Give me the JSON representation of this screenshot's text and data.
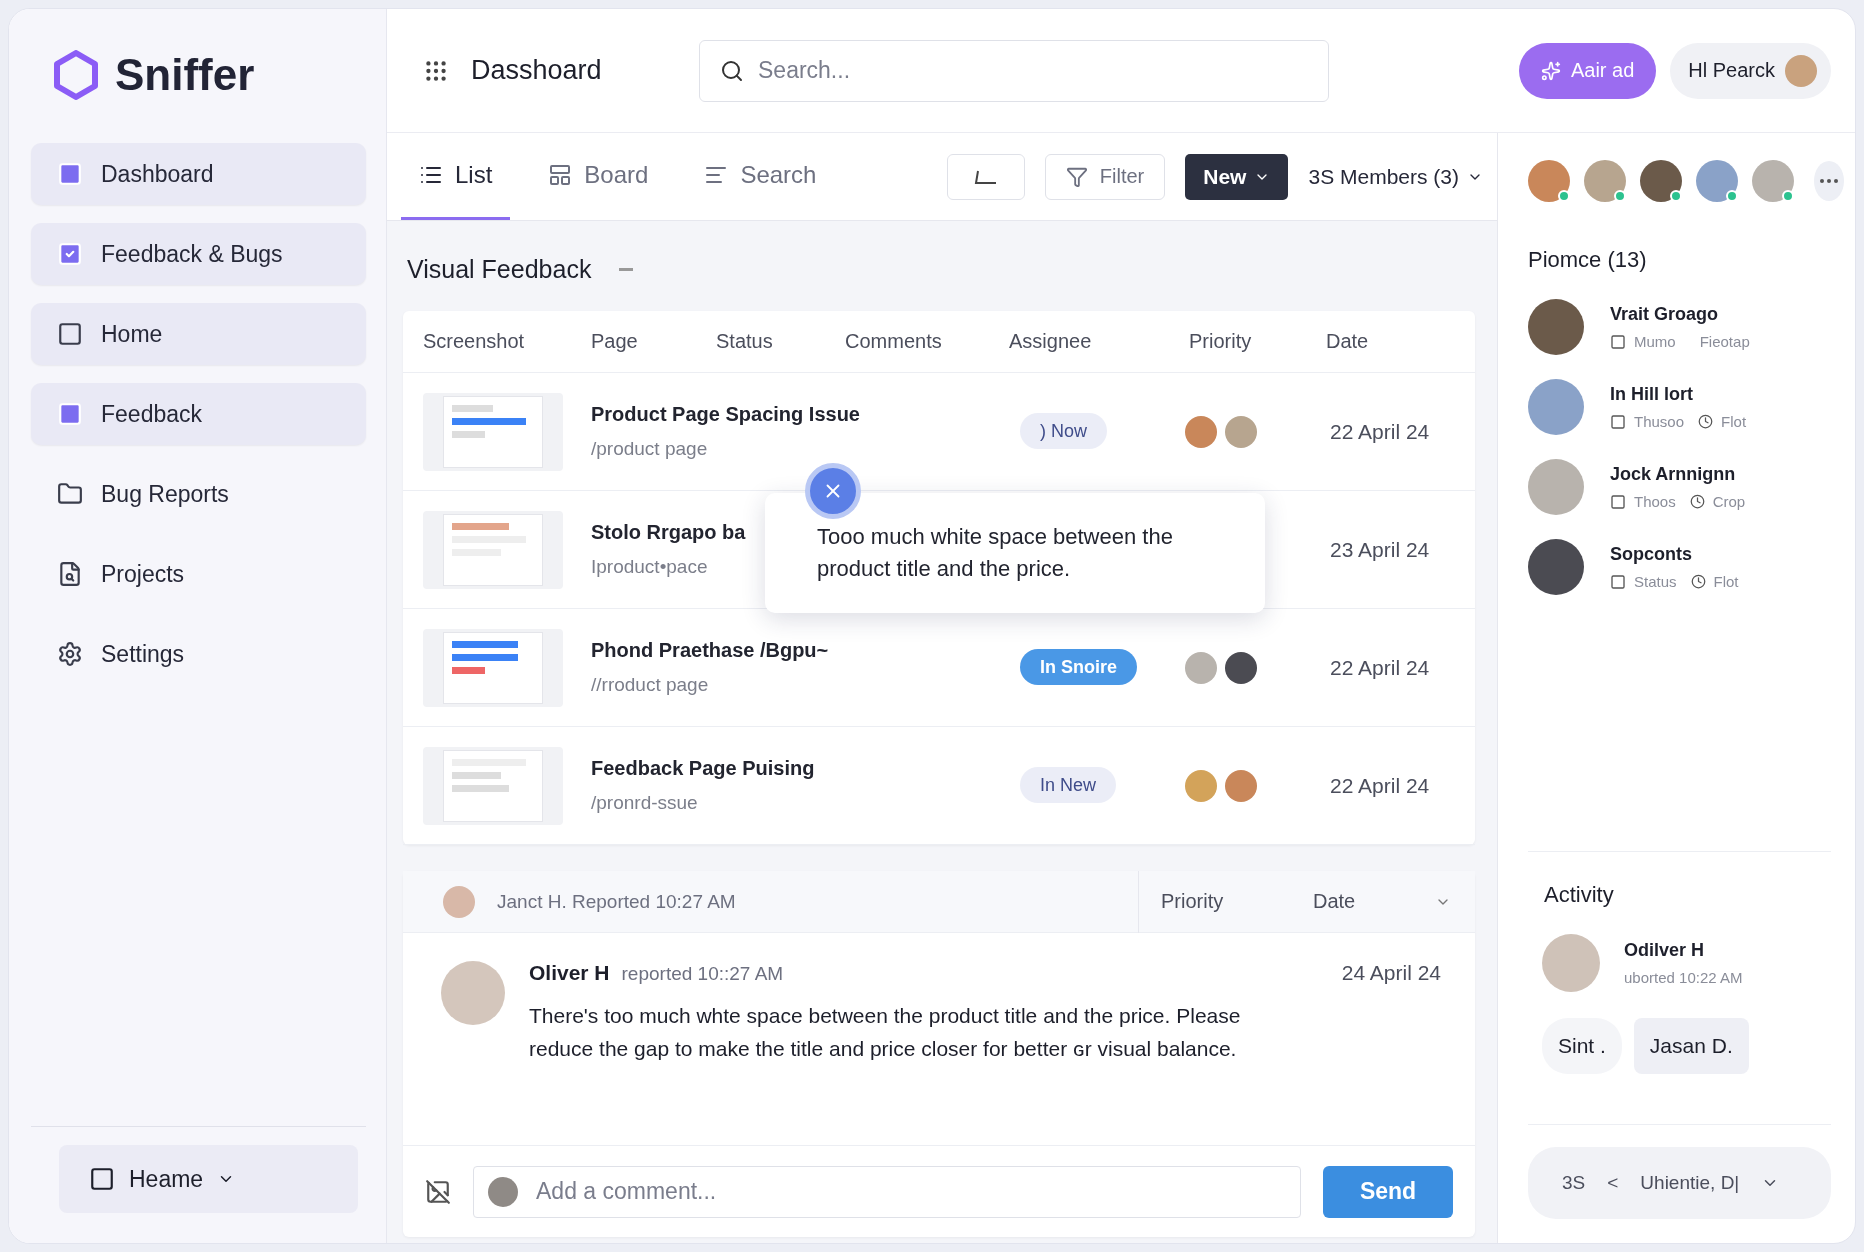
{
  "app": {
    "name": "Sniffer"
  },
  "sidebar": {
    "items": [
      {
        "label": "Dashboard",
        "highlighted": true
      },
      {
        "label": "Feedback & Bugs",
        "highlighted": true
      },
      {
        "label": "Home",
        "highlighted": true
      },
      {
        "label": "Feedback",
        "highlighted": true
      },
      {
        "label": "Bug Reports",
        "highlighted": false
      },
      {
        "label": "Projects",
        "highlighted": false
      },
      {
        "label": "Settings",
        "highlighted": false
      }
    ],
    "workspace": "Heame"
  },
  "header": {
    "title": "Dasshoard",
    "search": {
      "placeholder": "Search..."
    },
    "primary_button": "Aair ad",
    "user": "Hl Pearck"
  },
  "tabs": [
    {
      "label": "List",
      "selected": true
    },
    {
      "label": "Board",
      "selected": false
    },
    {
      "label": "Search",
      "selected": false
    }
  ],
  "toolbar": {
    "filter": "Filter",
    "new": "New",
    "members": "3S Members (3)"
  },
  "section_title": "Visual Feedback",
  "table": {
    "columns": [
      "Screenshot",
      "Page",
      "Status",
      "Comments",
      "Assignee",
      "Priority",
      "Date"
    ],
    "rows": [
      {
        "title": "Product Page Spacing Issue",
        "path": "/product page",
        "status": {
          "label": ") Now",
          "kind": "soft"
        },
        "date": "22 April 24"
      },
      {
        "title": "Stolo Rrgapo ba",
        "path": "Iproduct•pace",
        "date": "23 April 24"
      },
      {
        "title": "Phond Praethase /Bgpu~",
        "path": "//rroduct page",
        "status": {
          "label": "In Snoire",
          "kind": "solid"
        },
        "date": "22 April 24"
      },
      {
        "title": "Feedback Page Puising",
        "path": "/pronrd-ssue",
        "status": {
          "label": "In New",
          "kind": "soft"
        },
        "date": "22 April 24"
      }
    ]
  },
  "tooltip": {
    "text": "Tooo much white space between the product title and the price."
  },
  "comment_panel": {
    "reporter": "Janct H. Reported 10:27 AM",
    "columns": [
      "Priority",
      "Date"
    ],
    "comment": {
      "author": "Oliver H",
      "meta": "reported 10::27 AM",
      "date": "24 April 24",
      "body": "There's too much whte space between the product title and the price. Please reduce the gap to make the title and price closer for better ɢr visual balance."
    },
    "composer": {
      "placeholder": "Add a comment...",
      "send": "Send"
    }
  },
  "right_panel": {
    "avatars": [
      {
        "online": true
      },
      {
        "online": true
      },
      {
        "online": true
      },
      {
        "online": true
      },
      {
        "online": true
      }
    ],
    "people_title": "Piomce (13)",
    "people": [
      {
        "name": "Vrait Groago",
        "role": "Mumo",
        "tag": "Fieotap",
        "kind": "plain"
      },
      {
        "name": "In Hill lort",
        "role": "Thusoo",
        "tag": "Flot",
        "kind": "timed"
      },
      {
        "name": "Jock Arnnignn",
        "role": "Thoos",
        "tag": "Crop",
        "kind": "timed"
      },
      {
        "name": "Sopconts",
        "role": "Status",
        "tag": "Flot",
        "kind": "timed"
      }
    ],
    "activity": {
      "title": "Activity",
      "name": "Odilver H",
      "meta": "uborted 10:22 AM",
      "chips": [
        "Sint .",
        "Jasan D."
      ],
      "footer": {
        "count": "3S",
        "arrow": "<",
        "label": "Uhientie, D|"
      }
    }
  }
}
